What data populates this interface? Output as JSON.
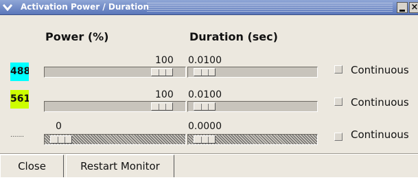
{
  "window": {
    "title": "Activation Power / Duration",
    "icons": {
      "menu": "chevron-down-icon",
      "minimize": "minimize-icon",
      "close": "close-icon"
    },
    "close_glyph": "×"
  },
  "headers": {
    "power": "Power (%)",
    "duration": "Duration (sec)"
  },
  "rows": [
    {
      "label": "488",
      "color": "#00ffff",
      "power": "100",
      "power_level": 1.0,
      "duration": "0.0100",
      "duration_level": 0.0,
      "continuous_label": "Continuous",
      "continuous_checked": false,
      "disabled": false
    },
    {
      "label": "561",
      "color": "#ccff00",
      "power": "100",
      "power_level": 1.0,
      "duration": "0.0100",
      "duration_level": 0.0,
      "continuous_label": "Continuous",
      "continuous_checked": false,
      "disabled": false
    },
    {
      "label": ".......",
      "color": "#ece8df",
      "power": "0",
      "power_level": 0.0,
      "duration": "0.0000",
      "duration_level": 0.0,
      "continuous_label": "Continuous",
      "continuous_checked": false,
      "disabled": true
    }
  ],
  "buttons": {
    "close": "Close",
    "restart": "Restart Monitor"
  }
}
